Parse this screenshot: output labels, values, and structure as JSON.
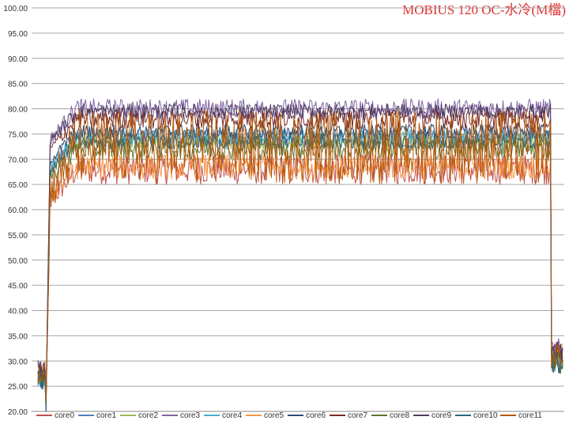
{
  "chart_data": {
    "type": "line",
    "title": "MOBIUS 120 OC-水冷(M檔)",
    "xlabel": "",
    "ylabel": "",
    "ylim": [
      20,
      100
    ],
    "yticks": [
      "20.00",
      "25.00",
      "30.00",
      "35.00",
      "40.00",
      "45.00",
      "50.00",
      "55.00",
      "60.00",
      "65.00",
      "70.00",
      "75.00",
      "80.00",
      "85.00",
      "90.00",
      "95.00",
      "100.00"
    ],
    "grid": true,
    "legend_position": "bottom",
    "samples": 520,
    "load_start_fraction": 0.015,
    "load_end_fraction": 0.975,
    "series": [
      {
        "name": "core0",
        "color": "#c0504d",
        "idle": 27,
        "low": 65,
        "high": 71,
        "tail": 31
      },
      {
        "name": "core1",
        "color": "#4f81bd",
        "idle": 26,
        "low": 72,
        "high": 76,
        "tail": 30
      },
      {
        "name": "core2",
        "color": "#9bbb59",
        "idle": 27,
        "low": 72,
        "high": 75,
        "tail": 31
      },
      {
        "name": "core3",
        "color": "#8064a2",
        "idle": 28,
        "low": 78,
        "high": 82,
        "tail": 32
      },
      {
        "name": "core4",
        "color": "#4bacc6",
        "idle": 27,
        "low": 73,
        "high": 76,
        "tail": 31
      },
      {
        "name": "core5",
        "color": "#f79646",
        "idle": 28,
        "low": 66,
        "high": 71,
        "tail": 31
      },
      {
        "name": "core6",
        "color": "#2c4d75",
        "idle": 26,
        "low": 74,
        "high": 77,
        "tail": 30
      },
      {
        "name": "core7",
        "color": "#772c2a",
        "idle": 27,
        "low": 76,
        "high": 80,
        "tail": 32
      },
      {
        "name": "core8",
        "color": "#5f7530",
        "idle": 27,
        "low": 70,
        "high": 74,
        "tail": 30
      },
      {
        "name": "core9",
        "color": "#4d3b62",
        "idle": 28,
        "low": 78,
        "high": 81,
        "tail": 31
      },
      {
        "name": "core10",
        "color": "#276a7c",
        "idle": 27,
        "low": 72,
        "high": 75,
        "tail": 30
      },
      {
        "name": "core11",
        "color": "#b65708",
        "idle": 28,
        "low": 65,
        "high": 80,
        "tail": 31
      }
    ]
  }
}
